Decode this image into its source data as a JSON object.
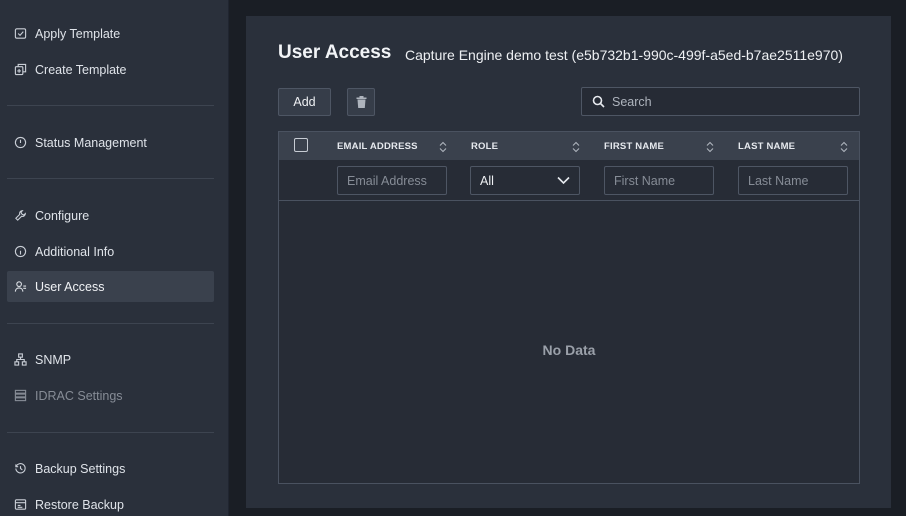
{
  "sidebar": {
    "items": [
      {
        "label": "Apply Template",
        "icon": "apply-template-icon"
      },
      {
        "label": "Create Template",
        "icon": "create-template-icon"
      },
      {
        "label": "Status Management",
        "icon": "status-icon"
      },
      {
        "label": "Configure",
        "icon": "wrench-icon"
      },
      {
        "label": "Additional Info",
        "icon": "info-icon"
      },
      {
        "label": "User Access",
        "icon": "user-icon",
        "active": true
      },
      {
        "label": "SNMP",
        "icon": "network-icon"
      },
      {
        "label": "IDRAC Settings",
        "icon": "server-icon",
        "disabled": true
      },
      {
        "label": "Backup Settings",
        "icon": "history-icon"
      },
      {
        "label": "Restore Backup",
        "icon": "restore-icon"
      }
    ]
  },
  "main": {
    "title": "User Access",
    "subtitle": "Capture Engine demo test (e5b732b1-990c-499f-a5ed-b7ae2511e970)"
  },
  "toolbar": {
    "add_label": "Add",
    "delete_icon": "trash-icon",
    "search_placeholder": "Search",
    "search_value": ""
  },
  "table": {
    "columns": [
      "EMAIL ADDRESS",
      "ROLE",
      "FIRST NAME",
      "LAST NAME"
    ],
    "filters": {
      "email_placeholder": "Email Address",
      "role_selected": "All",
      "first_name_placeholder": "First Name",
      "last_name_placeholder": "Last Name"
    },
    "empty_text": "No Data",
    "rows": []
  },
  "colors": {
    "background": "#1a1e25",
    "sidebar": "#2a303b",
    "panel": "#2a303b",
    "header": "#3a414d",
    "active_item": "#3a414d",
    "border": "#4e5664"
  }
}
